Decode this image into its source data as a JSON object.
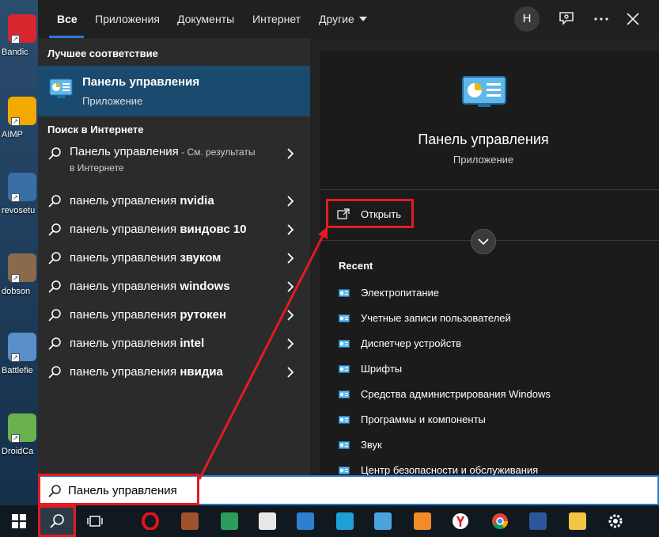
{
  "desktop": {
    "icons": [
      {
        "label": "Bandic",
        "color": "#d8262e"
      },
      {
        "label": "AIMP",
        "color": "#f2a900"
      },
      {
        "label": "revosetu",
        "color": "#3a6fa5"
      },
      {
        "label": "dobson",
        "color": "#8a6a4a"
      },
      {
        "label": "Battlefie",
        "color": "#5a8fc9"
      },
      {
        "label": "DroidCa",
        "color": "#6ab04c"
      }
    ]
  },
  "tabs": {
    "items": [
      "Все",
      "Приложения",
      "Документы",
      "Интернет",
      "Другие"
    ],
    "active": "Все",
    "avatar_letter": "Н",
    "icons": [
      "feedback-icon",
      "more-icon",
      "close-icon"
    ]
  },
  "left": {
    "best_match_header": "Лучшее соответствие",
    "best_match": {
      "title": "Панель управления",
      "subtitle": "Приложение",
      "icon": "control-panel-icon"
    },
    "web_header": "Поиск в Интернете",
    "web_results": [
      {
        "prefix": "Панель управления",
        "bold": "",
        "suffix": " - См. результаты",
        "sub": "в Интернете"
      },
      {
        "prefix": "панель управления ",
        "bold": "nvidia"
      },
      {
        "prefix": "панель управления ",
        "bold": "виндовс 10"
      },
      {
        "prefix": "панель управления ",
        "bold": "звуком"
      },
      {
        "prefix": "панель управления ",
        "bold": "windows"
      },
      {
        "prefix": "панель управления ",
        "bold": "рутокен"
      },
      {
        "prefix": "панель управления ",
        "bold": "intel"
      },
      {
        "prefix": "панель управления ",
        "bold": "нвидиа"
      }
    ]
  },
  "right": {
    "title": "Панель управления",
    "subtitle": "Приложение",
    "open_label": "Открыть",
    "recent_header": "Recent",
    "recent": [
      "Электропитание",
      "Учетные записи пользователей",
      "Диспетчер устройств",
      "Шрифты",
      "Средства администрирования Windows",
      "Программы и компоненты",
      "Звук",
      "Центр безопасности и обслуживания"
    ]
  },
  "search": {
    "value": "Панель управления"
  },
  "taskbar": {
    "apps": [
      {
        "name": "windows-start-icon",
        "color": "#ffffff"
      },
      {
        "name": "search-icon",
        "color": "#ffffff"
      },
      {
        "name": "task-view-icon",
        "color": "#ffffff"
      },
      {
        "name": "opera-icon",
        "color": "#e0141e"
      },
      {
        "name": "archive-icon",
        "color": "#a0522d"
      },
      {
        "name": "shield-app-icon",
        "color": "#2a9d5c"
      },
      {
        "name": "snipping-icon",
        "color": "#e8e8e8"
      },
      {
        "name": "mail-icon",
        "color": "#2f7fd1"
      },
      {
        "name": "l-app-icon",
        "color": "#1e9fd8"
      },
      {
        "name": "control-panel-icon",
        "color": "#4aa3df"
      },
      {
        "name": "sublime-icon",
        "color": "#f28c28"
      },
      {
        "name": "yandex-browser-icon",
        "color": "#ffffff"
      },
      {
        "name": "chrome-icon",
        "color": "#4caf50"
      },
      {
        "name": "word-icon",
        "color": "#2b579a"
      },
      {
        "name": "explorer-icon",
        "color": "#f4c542"
      },
      {
        "name": "settings-icon",
        "color": "#ffffff"
      }
    ]
  },
  "colors": {
    "accent": "#2b79d6",
    "highlight": "#1a4a6e",
    "annotation": "#e31b23"
  }
}
